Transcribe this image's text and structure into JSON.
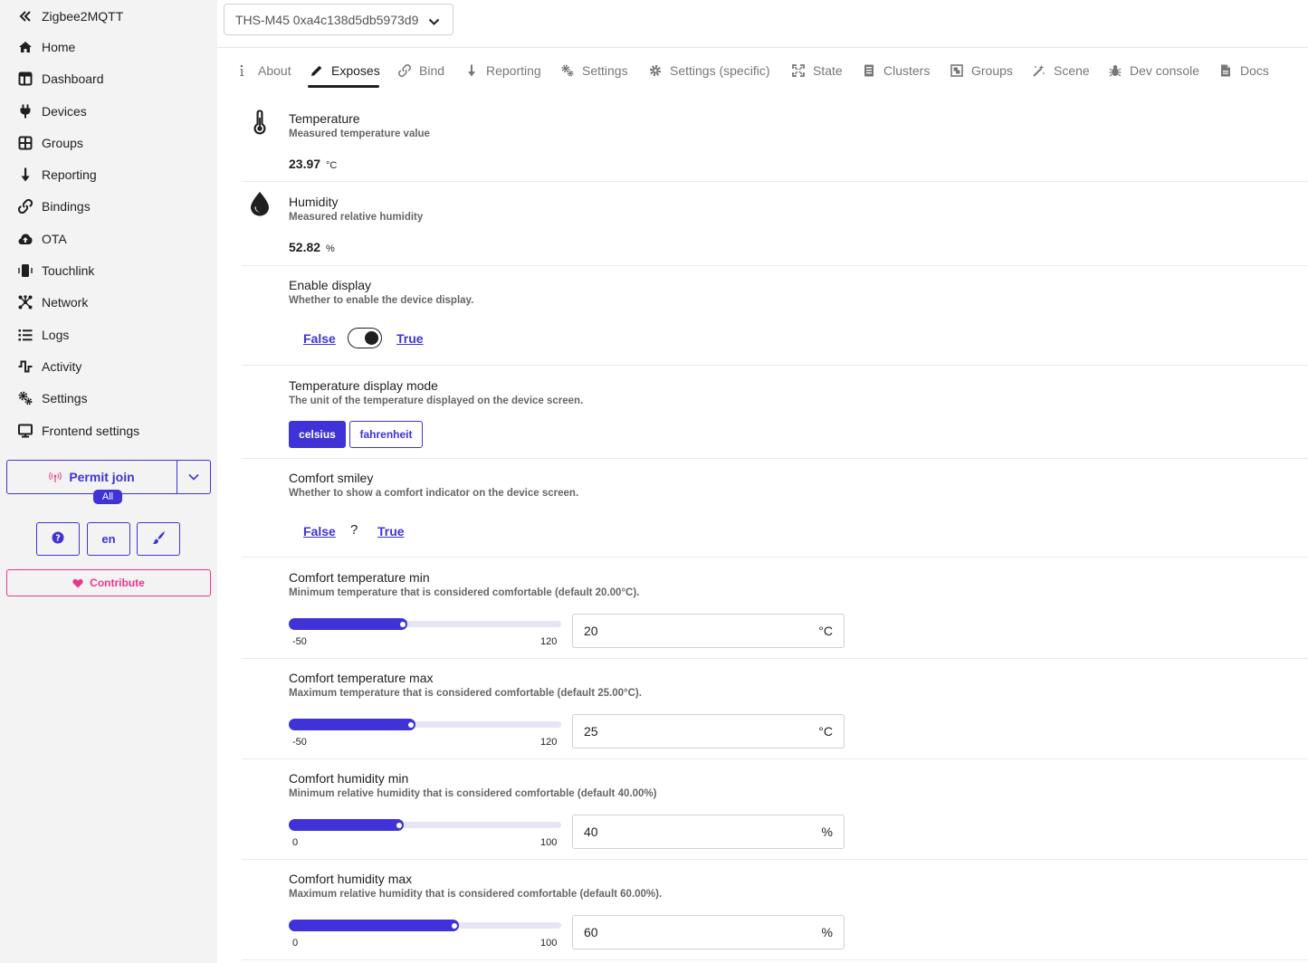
{
  "app": {
    "title": "Zigbee2MQTT"
  },
  "nav": {
    "items": [
      {
        "label": "Home"
      },
      {
        "label": "Dashboard"
      },
      {
        "label": "Devices"
      },
      {
        "label": "Groups"
      },
      {
        "label": "Reporting"
      },
      {
        "label": "Bindings"
      },
      {
        "label": "OTA"
      },
      {
        "label": "Touchlink"
      },
      {
        "label": "Network"
      },
      {
        "label": "Logs"
      },
      {
        "label": "Activity"
      },
      {
        "label": "Settings"
      },
      {
        "label": "Frontend settings"
      }
    ],
    "permit_join": "Permit join",
    "permit_badge": "All",
    "language": "en",
    "contribute": "Contribute"
  },
  "device_select": {
    "value": "THS-M45 0xa4c138d5db5973d9"
  },
  "tabs": [
    {
      "label": "About"
    },
    {
      "label": "Exposes"
    },
    {
      "label": "Bind"
    },
    {
      "label": "Reporting"
    },
    {
      "label": "Settings"
    },
    {
      "label": "Settings (specific)"
    },
    {
      "label": "State"
    },
    {
      "label": "Clusters"
    },
    {
      "label": "Groups"
    },
    {
      "label": "Scene"
    },
    {
      "label": "Dev console"
    },
    {
      "label": "Docs"
    }
  ],
  "active_tab": "Exposes",
  "colors": {
    "accent": "#3f33d8",
    "contribute": "#e8388c"
  },
  "features": {
    "temperature": {
      "title": "Temperature",
      "desc": "Measured temperature value",
      "value": "23.97",
      "unit": "°C"
    },
    "humidity": {
      "title": "Humidity",
      "desc": "Measured relative humidity",
      "value": "52.82",
      "unit": "%"
    },
    "enable_display": {
      "title": "Enable display",
      "desc": "Whether to enable the device display.",
      "false_label": "False",
      "true_label": "True",
      "state": true
    },
    "temp_display_mode": {
      "title": "Temperature display mode",
      "desc": "The unit of the temperature displayed on the device screen.",
      "options": [
        "celsius",
        "fahrenheit"
      ],
      "selected": "celsius"
    },
    "comfort_smiley": {
      "title": "Comfort smiley",
      "desc": "Whether to show a comfort indicator on the device screen.",
      "false_label": "False",
      "unknown": "?",
      "true_label": "True"
    },
    "comfort_temp_min": {
      "title": "Comfort temperature min",
      "desc": "Minimum temperature that is considered comfortable (default 20.00°C).",
      "min": -50,
      "max": 120,
      "min_label": "-50",
      "max_label": "120",
      "value": 20,
      "value_text": "20",
      "unit": "°C"
    },
    "comfort_temp_max": {
      "title": "Comfort temperature max",
      "desc": "Maximum temperature that is considered comfortable (default 25.00°C).",
      "min": -50,
      "max": 120,
      "min_label": "-50",
      "max_label": "120",
      "value": 25,
      "value_text": "25",
      "unit": "°C"
    },
    "comfort_hum_min": {
      "title": "Comfort humidity min",
      "desc": "Minimum relative humidity that is considered comfortable (default 40.00%)",
      "min": 0,
      "max": 100,
      "min_label": "0",
      "max_label": "100",
      "value": 40,
      "value_text": "40",
      "unit": "%"
    },
    "comfort_hum_max": {
      "title": "Comfort humidity max",
      "desc": "Maximum relative humidity that is considered comfortable (default 60.00%).",
      "min": 0,
      "max": 100,
      "min_label": "0",
      "max_label": "100",
      "value": 60,
      "value_text": "60",
      "unit": "%"
    }
  }
}
